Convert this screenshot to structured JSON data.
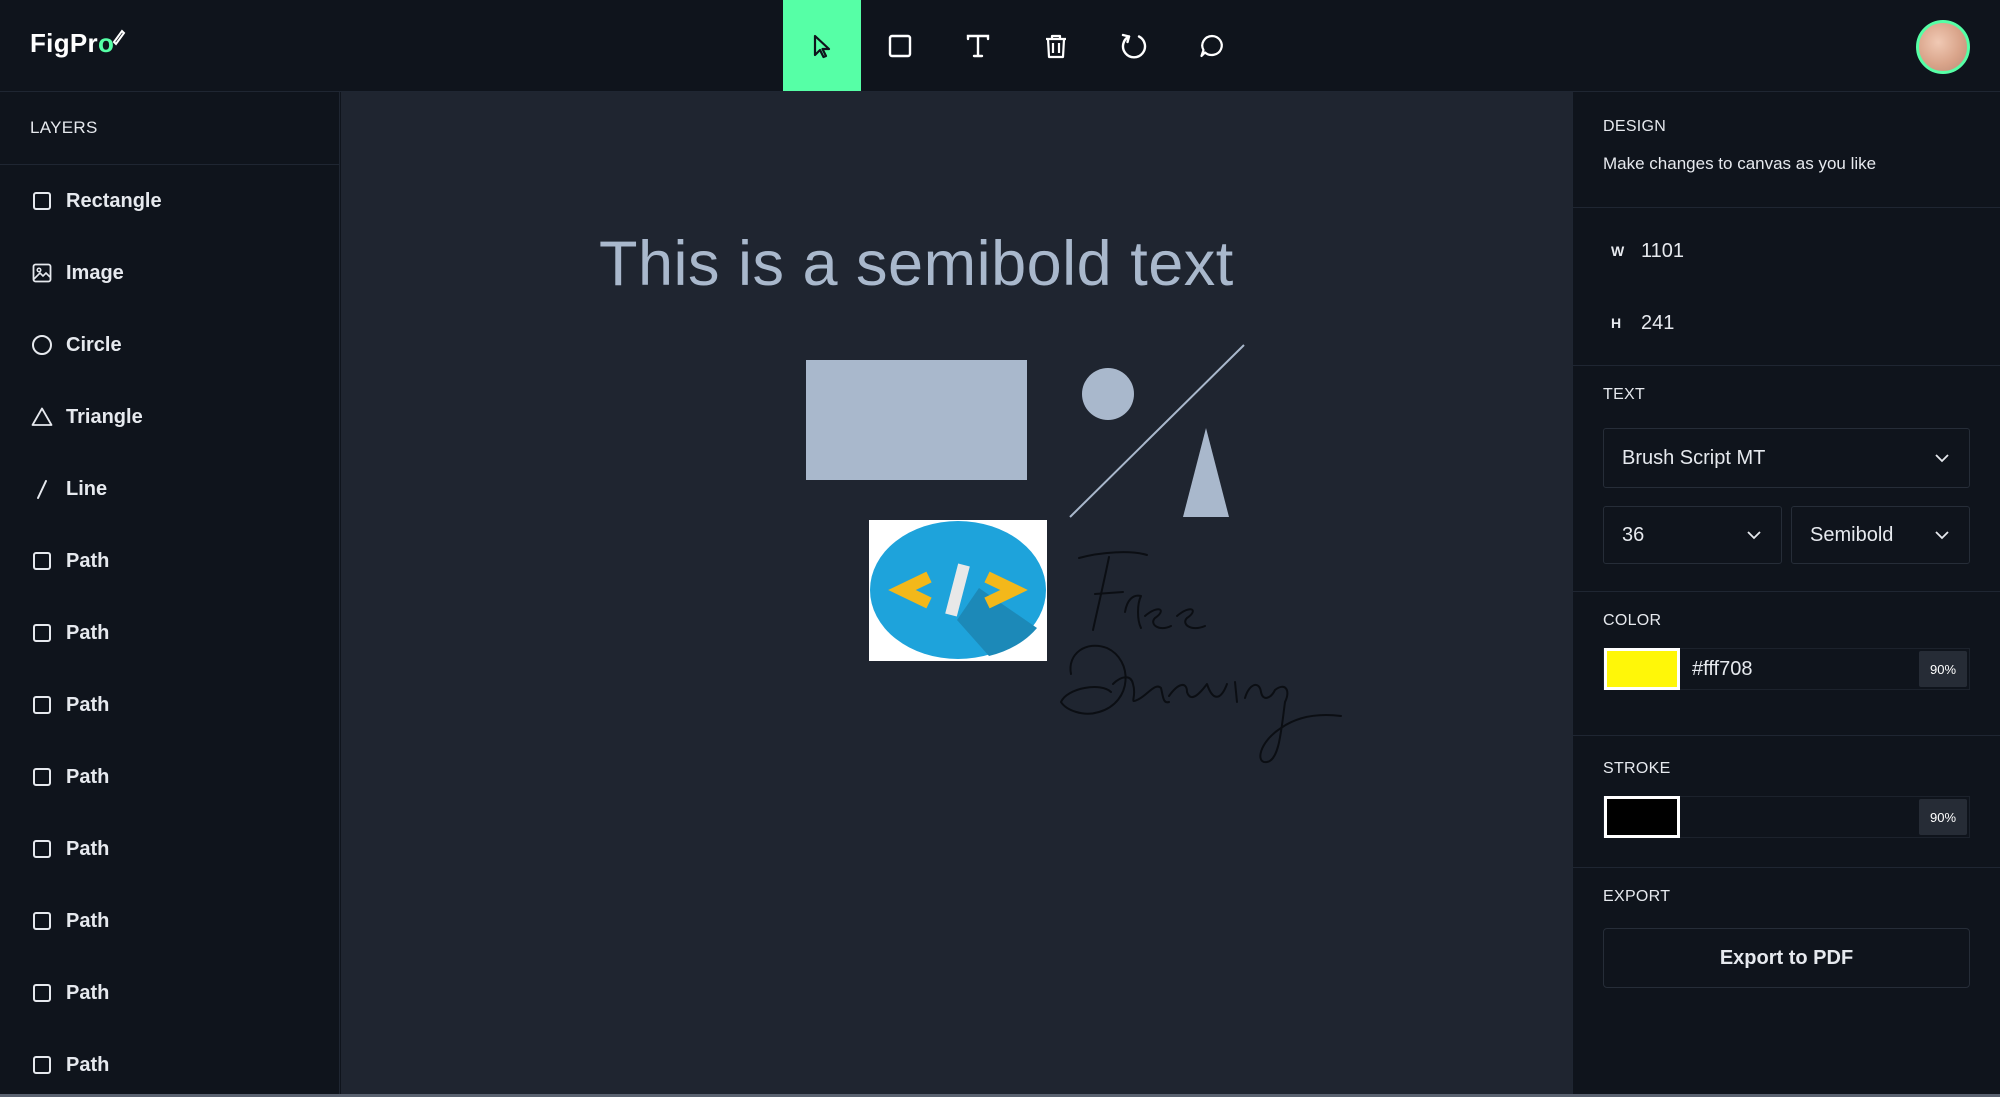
{
  "app": {
    "logo_main": "FigPr",
    "logo_accent": "o"
  },
  "toolbar": {
    "tools": [
      {
        "name": "select",
        "icon": "cursor-icon",
        "active": true
      },
      {
        "name": "rectangle",
        "icon": "square-icon",
        "active": false
      },
      {
        "name": "text",
        "icon": "text-icon",
        "active": false
      },
      {
        "name": "delete",
        "icon": "trash-icon",
        "active": false
      },
      {
        "name": "reset",
        "icon": "reset-icon",
        "active": false
      },
      {
        "name": "comments",
        "icon": "comment-icon",
        "active": false
      }
    ],
    "accent_color": "#56ffa6"
  },
  "layers": {
    "title": "LAYERS",
    "items": [
      {
        "label": "Rectangle",
        "icon": "square-icon"
      },
      {
        "label": "Image",
        "icon": "image-icon"
      },
      {
        "label": "Circle",
        "icon": "circle-icon"
      },
      {
        "label": "Triangle",
        "icon": "triangle-icon"
      },
      {
        "label": "Line",
        "icon": "line-icon"
      },
      {
        "label": "Path",
        "icon": "square-icon"
      },
      {
        "label": "Path",
        "icon": "square-icon"
      },
      {
        "label": "Path",
        "icon": "square-icon"
      },
      {
        "label": "Path",
        "icon": "square-icon"
      },
      {
        "label": "Path",
        "icon": "square-icon"
      },
      {
        "label": "Path",
        "icon": "square-icon"
      },
      {
        "label": "Path",
        "icon": "square-icon"
      },
      {
        "label": "Path",
        "icon": "square-icon"
      }
    ]
  },
  "canvas": {
    "text": "This is a semibold text",
    "shape_color": "#a9b8cc",
    "code_logo_text": "</>"
  },
  "design": {
    "title": "DESIGN",
    "subtitle": "Make changes to canvas as you like",
    "width_label": "W",
    "width_value": "1101",
    "height_label": "H",
    "height_value": "241",
    "text_title": "TEXT",
    "font_family": "Brush Script MT",
    "font_size": "36",
    "font_weight": "Semibold",
    "color_title": "COLOR",
    "fill_color": "#fff708",
    "fill_opacity": "90%",
    "stroke_title": "STROKE",
    "stroke_color": "#000000",
    "stroke_opacity": "90%",
    "export_title": "EXPORT",
    "export_button": "Export to PDF"
  }
}
